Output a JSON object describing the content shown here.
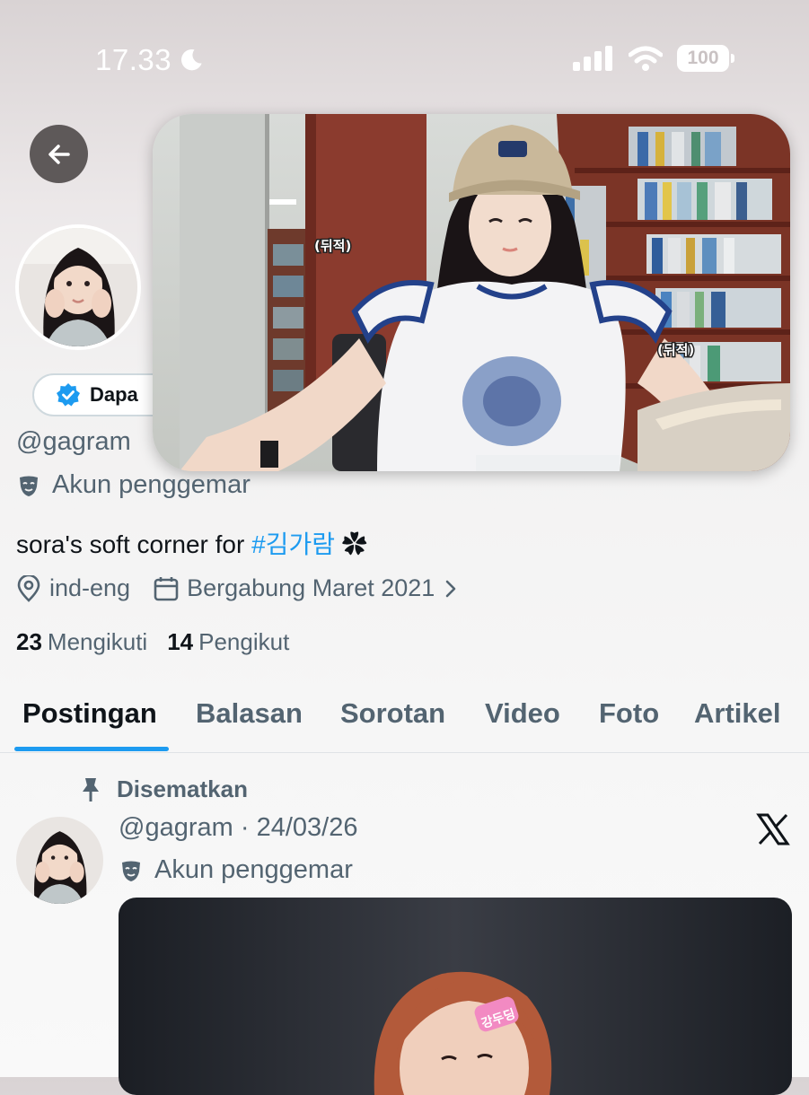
{
  "status_bar": {
    "time": "17.33",
    "battery": "100"
  },
  "profile": {
    "handle": "@gagram",
    "account_type": "Akun penggemar",
    "follow_pill_label": "Dapa",
    "bio_text": "sora's soft corner for ",
    "bio_hashtag": "#김가람",
    "bio_emoji": "✿",
    "location": "ind-eng",
    "joined": "Bergabung Maret 2021",
    "following_count": "23",
    "following_label": "Mengikuti",
    "followers_count": "14",
    "followers_label": "Pengikut"
  },
  "video": {
    "caption_left": "(뒤적)",
    "caption_right": "(뒤적)"
  },
  "tabs": [
    {
      "label": "Postingan",
      "active": true
    },
    {
      "label": "Balasan"
    },
    {
      "label": "Sorotan"
    },
    {
      "label": "Video"
    },
    {
      "label": "Foto"
    },
    {
      "label": "Artikel"
    }
  ],
  "pinned_post": {
    "pinned_label": "Disematkan",
    "handle": "@gagram",
    "separator": "·",
    "date": "24/03/26",
    "account_type": "Akun penggemar",
    "hairclip_text": "강두딩"
  },
  "colors": {
    "accent": "#1d9bf0",
    "text": "#0f1419",
    "secondary": "#536471"
  },
  "icons": [
    "back-arrow-icon",
    "moon-icon",
    "signal-icon",
    "wifi-icon",
    "battery-icon",
    "verified-badge-icon",
    "fan-mask-icon",
    "location-pin-icon",
    "calendar-icon",
    "chevron-right-icon",
    "pin-icon",
    "x-logo-icon"
  ]
}
